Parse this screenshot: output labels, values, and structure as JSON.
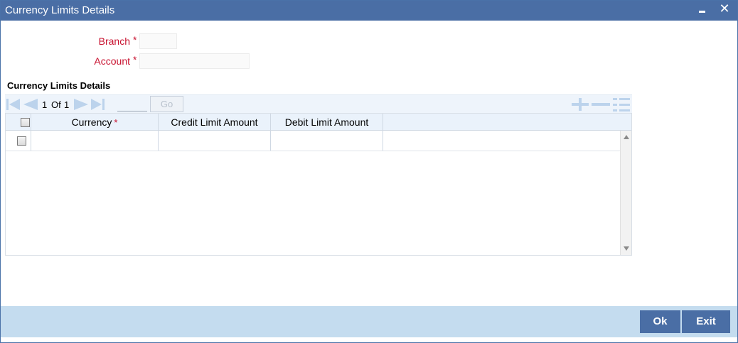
{
  "window": {
    "title": "Currency Limits Details"
  },
  "form": {
    "branch_label": "Branch",
    "branch_value": "",
    "account_label": "Account",
    "account_value": "",
    "required_mark": "*"
  },
  "section": {
    "title": "Currency Limits Details"
  },
  "pager": {
    "current": "1",
    "of_label": "Of",
    "total": "1",
    "go_label": "Go"
  },
  "grid": {
    "columns": [
      {
        "label": "Currency",
        "required": true
      },
      {
        "label": "Credit Limit Amount"
      },
      {
        "label": "Debit Limit Amount"
      }
    ],
    "rows": [
      {
        "currency": "",
        "credit_limit": "",
        "debit_limit": ""
      }
    ]
  },
  "footer": {
    "ok_label": "Ok",
    "exit_label": "Exit"
  },
  "colors": {
    "titlebar": "#4a6ea5",
    "required": "#c8102e",
    "footer": "#c4dcef",
    "toolbar_icons": "#bcd3ec"
  }
}
